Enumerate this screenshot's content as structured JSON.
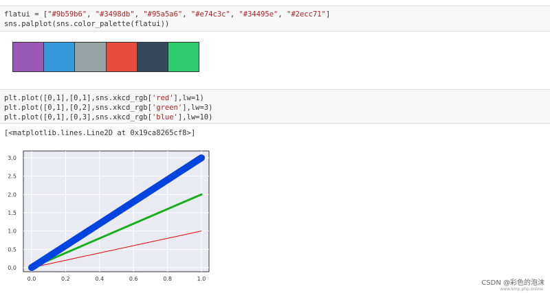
{
  "cell1": {
    "line1_prefix": "flatui = [",
    "colors_strs": [
      "\"#9b59b6\"",
      "\"#3498db\"",
      "\"#95a5a6\"",
      "\"#e74c3c\"",
      "\"#34495e\"",
      "\"#2ecc71\""
    ],
    "line2": "sns.palplot(sns.color_palette(flatui))"
  },
  "palette": [
    "#9b59b6",
    "#3498db",
    "#95a5a6",
    "#e74c3c",
    "#34495e",
    "#2ecc71"
  ],
  "cell2": {
    "lines": [
      {
        "prefix": "plt.plot([0,1],[0,1],sns.xkcd_rgb[",
        "str": "'red'",
        "suffix": "],lw=1)"
      },
      {
        "prefix": "plt.plot([0,1],[0,2],sns.xkcd_rgb[",
        "str": "'green'",
        "suffix": "],lw=3)"
      },
      {
        "prefix": "plt.plot([0,1],[0,3],sns.xkcd_rgb[",
        "str": "'blue'",
        "suffix": "],lw=10)"
      }
    ]
  },
  "output_text": "[<matplotlib.lines.Line2D at 0x19ca8265cf8>]",
  "chart_data": {
    "type": "line",
    "xlim": [
      0,
      1
    ],
    "ylim": [
      0,
      3
    ],
    "xticks": [
      "0.0",
      "0.2",
      "0.4",
      "0.6",
      "0.8",
      "1.0"
    ],
    "yticks": [
      "0.0",
      "0.5",
      "1.0",
      "1.5",
      "2.0",
      "2.5",
      "3.0"
    ],
    "grid": true,
    "background": "#eaeaf2",
    "series": [
      {
        "x": [
          0,
          1
        ],
        "y": [
          0,
          1
        ],
        "color": "#e50000",
        "lw": 1
      },
      {
        "x": [
          0,
          1
        ],
        "y": [
          0,
          2
        ],
        "color": "#15b01a",
        "lw": 3
      },
      {
        "x": [
          0,
          1
        ],
        "y": [
          0,
          3
        ],
        "color": "#0343df",
        "lw": 10
      }
    ]
  },
  "watermark": "CSDN @彩色的泡沫",
  "sub_watermark": "www.kmp.php.online"
}
